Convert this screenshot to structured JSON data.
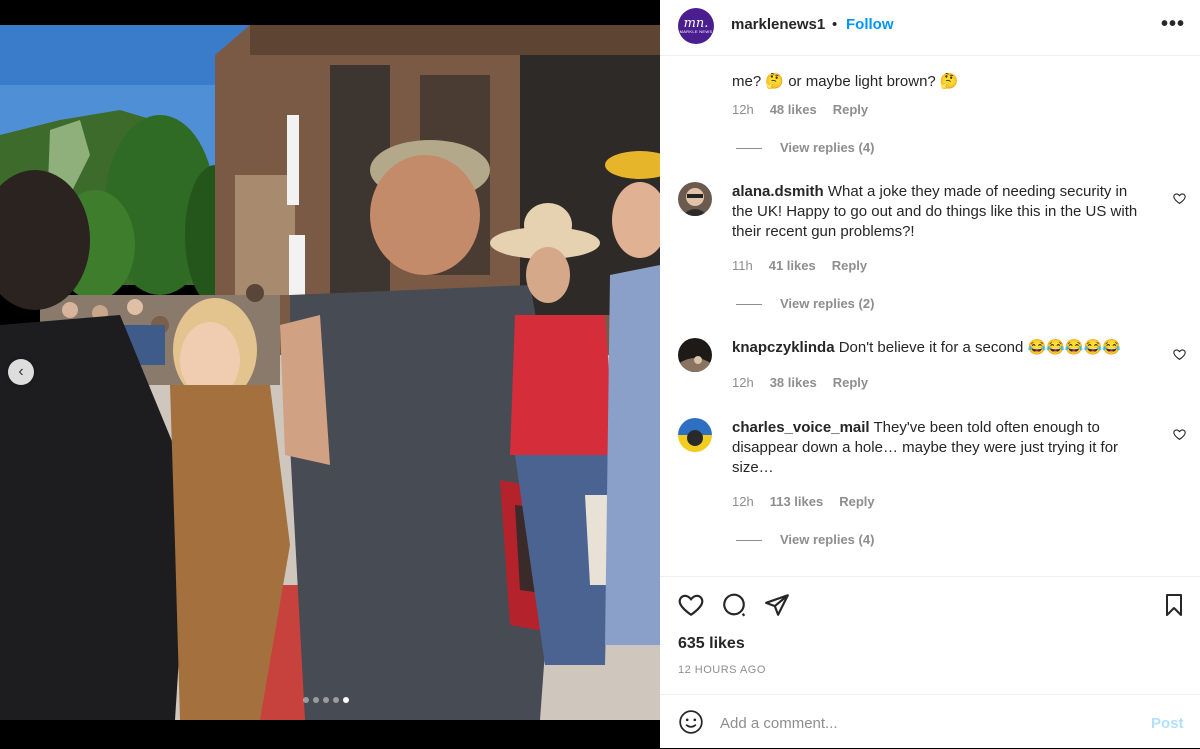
{
  "post": {
    "username": "marklenews1",
    "avatar_text": "mn.",
    "avatar_subtext": "MARKLE NEWS",
    "separator": "•",
    "follow_label": "Follow",
    "more_label": "•••",
    "likes_total": "635 likes",
    "time_ago": "12 HOURS AGO"
  },
  "comments": [
    {
      "username": "",
      "text": "me? 🤔 or maybe light brown? 🤔",
      "time": "12h",
      "likes": "48 likes",
      "reply_label": "Reply",
      "replies_label": "View replies (4)"
    },
    {
      "username": "alana.dsmith",
      "text": "What a joke they made of needing security in the UK! Happy to go out and do things like this in the US with their recent gun problems?!",
      "time": "11h",
      "likes": "41 likes",
      "reply_label": "Reply",
      "replies_label": "View replies (2)"
    },
    {
      "username": "knapczyklinda",
      "text": "Don't believe it for a second 😂😂😂😂😂",
      "time": "12h",
      "likes": "38 likes",
      "reply_label": "Reply",
      "replies_label": ""
    },
    {
      "username": "charles_voice_mail",
      "text": "They've been told often enough to disappear down a hole… maybe they were just trying it for size…",
      "time": "12h",
      "likes": "113 likes",
      "reply_label": "Reply",
      "replies_label": "View replies (4)"
    }
  ],
  "add_comment": {
    "placeholder": "Add a comment...",
    "post_label": "Post"
  },
  "icons": {
    "prev": "chevron-left-icon",
    "like": "heart-icon",
    "comment": "comment-bubble-icon",
    "share": "paper-plane-icon",
    "save": "bookmark-icon",
    "emoji": "smiley-icon"
  },
  "colors": {
    "accent": "#0095f6",
    "post_disabled": "#b2dffc",
    "muted": "#8e8e8e",
    "text": "#262626"
  },
  "carousel": {
    "total": 5,
    "active_index": 5
  }
}
